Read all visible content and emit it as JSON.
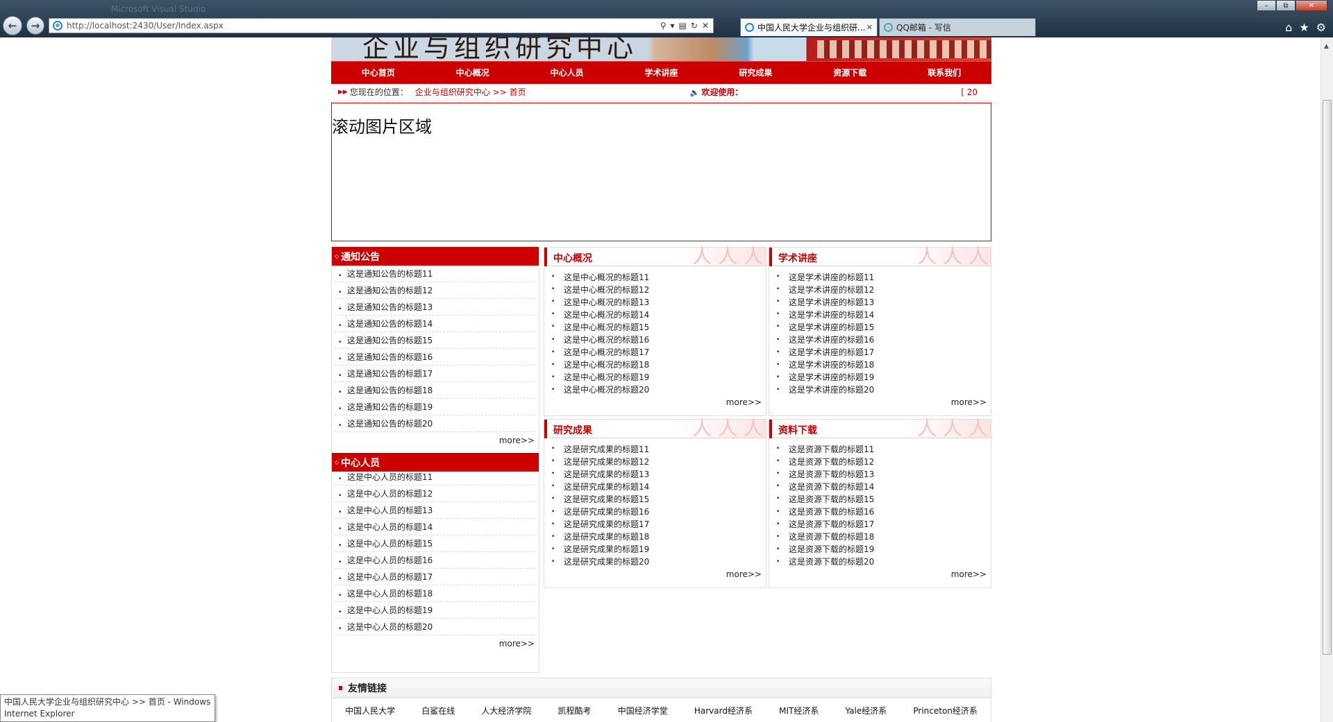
{
  "browser": {
    "title_faint": "Microsoft Visual Studio",
    "url": "http://localhost:2430/User/Index.aspx",
    "tabs": [
      {
        "label": "中国人民大学企业与组织研..."
      },
      {
        "label": "QQ邮箱 - 写信"
      }
    ],
    "tooltip": "中国人民大学企业与组织研究中心 >> 首页 - Windows Internet Explorer"
  },
  "banner": {
    "text": "企业与组织研究中心"
  },
  "nav": [
    "中心首页",
    "中心概况",
    "中心人员",
    "学术讲座",
    "研究成果",
    "资源下载",
    "联系我们"
  ],
  "location": {
    "label": "您现在的位置：",
    "path": "企业与组织研究中心 >> 首页",
    "welcome": "欢迎使用：",
    "marquee": "[ 20"
  },
  "scroll_area": {
    "title": "滚动图片区域"
  },
  "more_label": "more>>",
  "notice": {
    "title": "通知公告",
    "items": [
      "这是通知公告的标题11",
      "这是通知公告的标题12",
      "这是通知公告的标题13",
      "这是通知公告的标题14",
      "这是通知公告的标题15",
      "这是通知公告的标题16",
      "这是通知公告的标题17",
      "这是通知公告的标题18",
      "这是通知公告的标题19",
      "这是通知公告的标题20"
    ]
  },
  "staff": {
    "title": "中心人员",
    "items": [
      "这是中心人员的标题11",
      "这是中心人员的标题12",
      "这是中心人员的标题13",
      "这是中心人员的标题14",
      "这是中心人员的标题15",
      "这是中心人员的标题16",
      "这是中心人员的标题17",
      "这是中心人员的标题18",
      "这是中心人员的标题19",
      "这是中心人员的标题20"
    ]
  },
  "overview": {
    "title": "中心概况",
    "items": [
      "这是中心概况的标题11",
      "这是中心概况的标题12",
      "这是中心概况的标题13",
      "这是中心概况的标题14",
      "这是中心概况的标题15",
      "这是中心概况的标题16",
      "这是中心概况的标题17",
      "这是中心概况的标题18",
      "这是中心概况的标题19",
      "这是中心概况的标题20"
    ]
  },
  "lectures": {
    "title": "学术讲座",
    "items": [
      "这是学术讲座的标题11",
      "这是学术讲座的标题12",
      "这是学术讲座的标题13",
      "这是学术讲座的标题14",
      "这是学术讲座的标题15",
      "这是学术讲座的标题16",
      "这是学术讲座的标题17",
      "这是学术讲座的标题18",
      "这是学术讲座的标题19",
      "这是学术讲座的标题20"
    ]
  },
  "research": {
    "title": "研究成果",
    "items": [
      "这是研究成果的标题11",
      "这是研究成果的标题12",
      "这是研究成果的标题13",
      "这是研究成果的标题14",
      "这是研究成果的标题15",
      "这是研究成果的标题16",
      "这是研究成果的标题17",
      "这是研究成果的标题18",
      "这是研究成果的标题19",
      "这是研究成果的标题20"
    ]
  },
  "downloads": {
    "title": "资料下载",
    "items": [
      "这是资源下载的标题11",
      "这是资源下载的标题12",
      "这是资源下载的标题13",
      "这是资源下载的标题14",
      "这是资源下载的标题15",
      "这是资源下载的标题16",
      "这是资源下载的标题17",
      "这是资源下载的标题18",
      "这是资源下载的标题19",
      "这是资源下载的标题20"
    ]
  },
  "friends": {
    "title": "友情链接",
    "links": [
      "中国人民大学",
      "白鲨在线",
      "人大经济学院",
      "凯程酷考",
      "中国经济学堂",
      "Harvard经济系",
      "MIT经济系",
      "Yale经济系",
      "Princeton经济系"
    ]
  },
  "colors": {
    "accent": "#cc0000",
    "header_bg": "#1f3142"
  }
}
